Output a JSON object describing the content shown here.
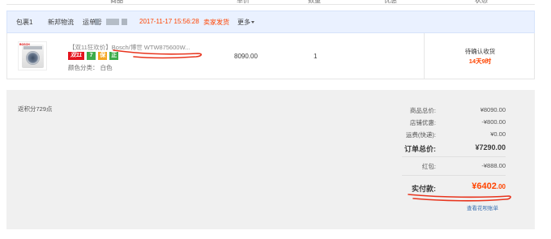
{
  "columns": {
    "product": "商品",
    "unit_price": "单价",
    "quantity": "数量",
    "discount": "优惠",
    "status": "状态"
  },
  "order": {
    "package": "包裹1",
    "carrier": "新邦物流",
    "tracking_prefix": "运单号",
    "datetime": "2017-11-17 15:56:28",
    "contact_seller": "卖家发货",
    "more": "更多"
  },
  "item": {
    "title": "【双11狂欢价】Bosch/博世 WTW875600W...",
    "badges": [
      "双11",
      "7",
      "保",
      "正"
    ],
    "thumb_brand": "BOSCH",
    "spec_label": "颜色分类：",
    "spec_value": "白色",
    "price": "8090.00",
    "quantity": "1",
    "status": "待确认收货",
    "countdown": "14天9时"
  },
  "summary": {
    "points_return": "返积分729点",
    "rows": [
      {
        "label": "商品总价:",
        "value": "¥8090.00"
      },
      {
        "label": "店铺优惠:",
        "value": "-¥800.00"
      },
      {
        "label": "运费(快递):",
        "value": "¥0.00"
      },
      {
        "label": "订单总价:",
        "value": "¥7290.00"
      },
      {
        "label": "红包:",
        "value": "-¥888.00"
      }
    ],
    "paid_label": "实付款:",
    "paid_main": "¥6402",
    "paid_cents": ".00",
    "detail_link": "查看花呗账单"
  },
  "colors": {
    "accent": "#ff4400",
    "order_bar_bg": "#eaf1ff",
    "summary_bg": "#f0f0f0",
    "link": "#3a6fb0",
    "annotation": "#e8351e"
  }
}
